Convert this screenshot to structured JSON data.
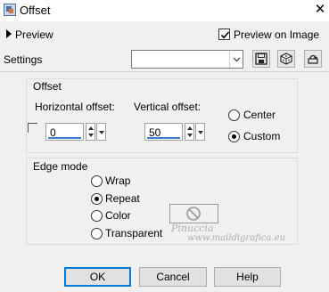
{
  "window": {
    "title": "Offset",
    "close_glyph": "✕",
    "icon": "offset-app-icon"
  },
  "preview": {
    "toggle_label": "Preview",
    "preview_on_image_label": "Preview on Image",
    "preview_on_image_checked": true
  },
  "settings": {
    "label": "Settings",
    "preset_value": "",
    "tools": [
      "save-preset-icon",
      "randomize-dice-icon",
      "reset-icon"
    ]
  },
  "offset_group": {
    "title": "Offset",
    "horizontal_label": "Horizontal offset:",
    "horizontal_value": "0",
    "vertical_label": "Vertical offset:",
    "vertical_value": "50",
    "link_checked": false,
    "modes": [
      {
        "label": "Center",
        "selected": false
      },
      {
        "label": "Custom",
        "selected": true
      }
    ]
  },
  "edge_group": {
    "title": "Edge mode",
    "options": [
      {
        "label": "Wrap",
        "selected": false
      },
      {
        "label": "Repeat",
        "selected": true
      },
      {
        "label": "Color",
        "selected": false
      },
      {
        "label": "Transparent",
        "selected": false
      }
    ]
  },
  "watermark": {
    "name": "Pinuccia",
    "site": "www.maildigrafica.eu"
  },
  "buttons": {
    "ok": "OK",
    "cancel": "Cancel",
    "help": "Help"
  },
  "colors": {
    "accent": "#0078d7",
    "dialog_bg": "#f0f0f0"
  }
}
